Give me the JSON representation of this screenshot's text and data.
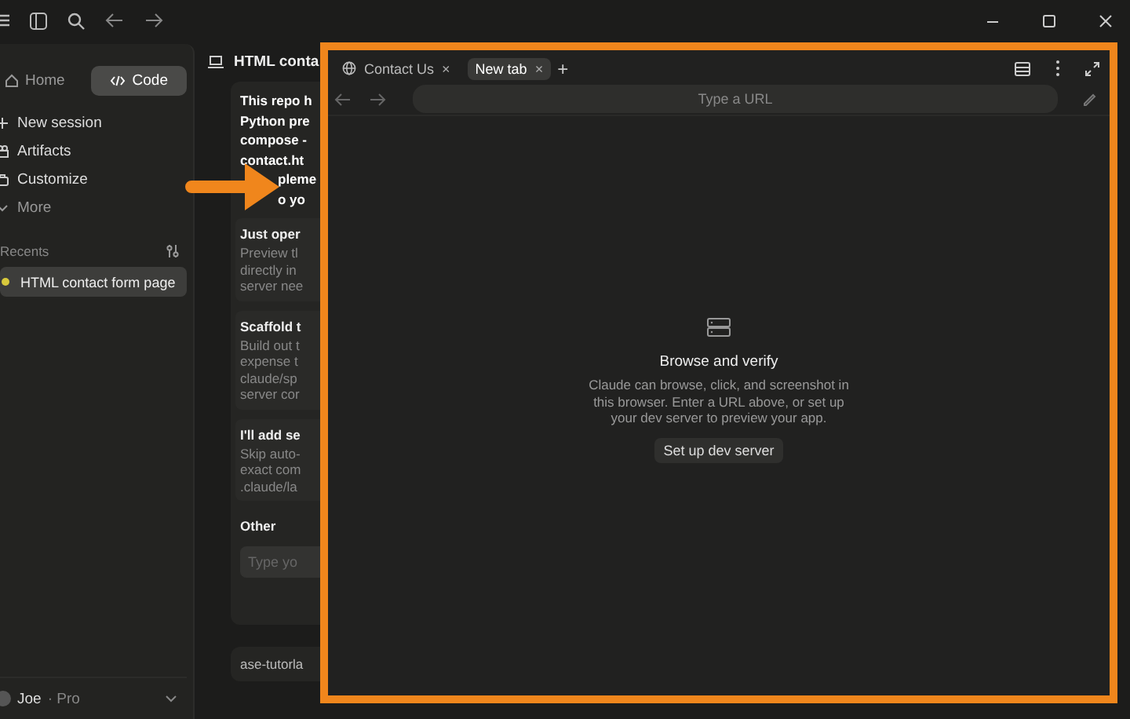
{
  "sidebar": {
    "modes": [
      {
        "label": "Home",
        "kind": "home",
        "selected": false
      },
      {
        "label": "Code",
        "kind": "code",
        "selected": true
      }
    ],
    "items": [
      {
        "label": "New session",
        "kind": "plus"
      },
      {
        "label": "Artifacts",
        "kind": "artifacts"
      },
      {
        "label": "Customize",
        "kind": "customize"
      },
      {
        "label": "More",
        "kind": "more"
      }
    ],
    "recents_label": "Recents",
    "recents": [
      {
        "label": "HTML contact form page",
        "selected": true,
        "color": "#d8c93c"
      }
    ],
    "user": {
      "name": "Joe",
      "plan": "· Pro"
    }
  },
  "session": {
    "title": "HTML conta",
    "message_lines": [
      "This repo h",
      "Python pre",
      "compose -",
      "contact.ht",
      "pleme",
      "o yo"
    ],
    "options": [
      {
        "title": "Just oper",
        "lines": [
          "Preview tl",
          "directly in",
          "server nee"
        ]
      },
      {
        "title": "Scaffold t",
        "lines": [
          "Build out t",
          "expense t",
          "claude/sp",
          "server cor"
        ]
      },
      {
        "title": "I'll add se",
        "lines": [
          "Skip auto-",
          "exact com",
          ".claude/la"
        ]
      }
    ],
    "other": {
      "label": "Other",
      "placeholder": "Type yo"
    },
    "footer": "ase-tutorla"
  },
  "browser": {
    "tabs": [
      {
        "label": "Contact Us",
        "kind": "web",
        "selected": false,
        "close": "×"
      },
      {
        "label": "New tab",
        "kind": "blank",
        "selected": true,
        "close": "×"
      }
    ],
    "new_tab": "+",
    "url": {
      "placeholder": "Type a URL"
    },
    "empty": {
      "title": "Browse and verify",
      "text": "Claude can browse, click, and screenshot in this browser. Enter a URL above, or set up your dev server to preview your app.",
      "button": "Set up dev server"
    }
  }
}
